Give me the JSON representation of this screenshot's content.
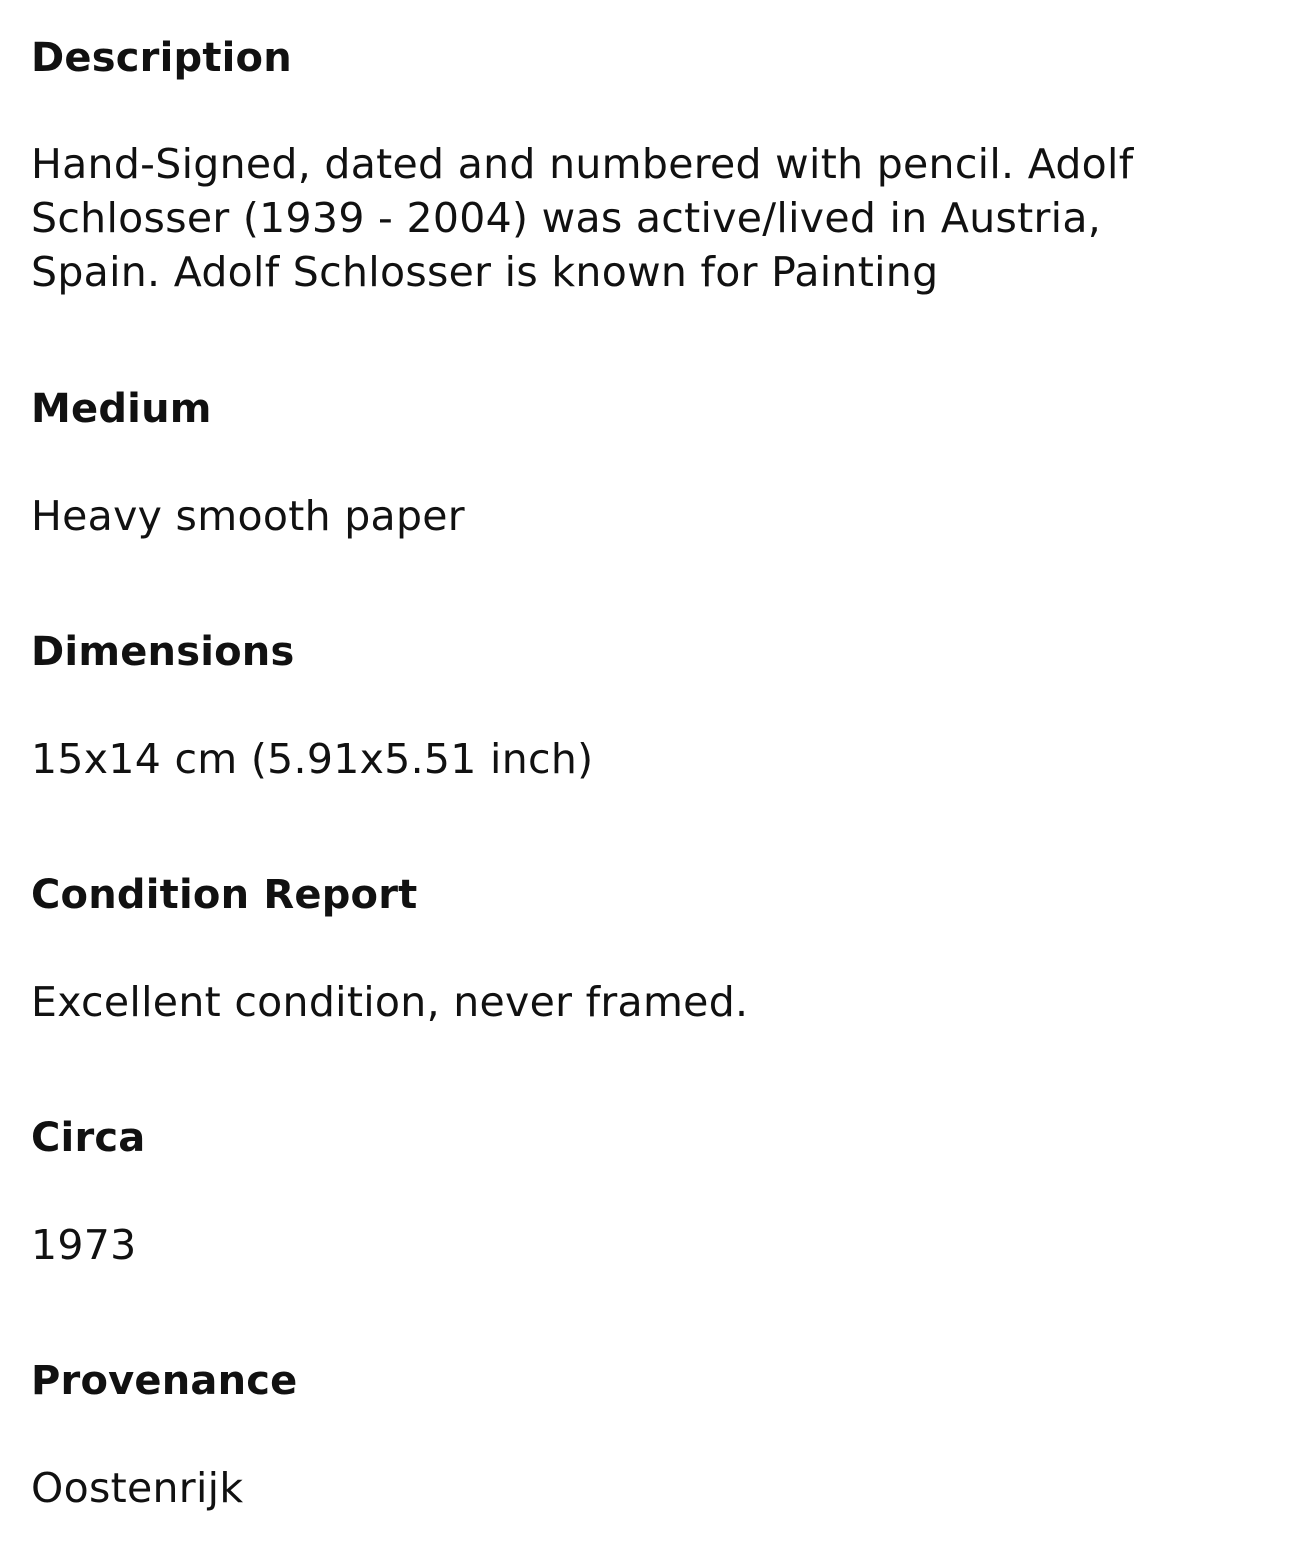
{
  "sections": {
    "description": {
      "heading": "Description",
      "lines": [
        "Hand-Signed, dated and numbered with pencil. Adolf",
        "Schlosser (1939 - 2004) was active/lived in Austria,",
        "Spain. Adolf Schlosser is known for Painting"
      ]
    },
    "medium": {
      "heading": "Medium",
      "value": "Heavy smooth paper"
    },
    "dimensions": {
      "heading": "Dimensions",
      "value": "15x14 cm (5.91x5.51 inch)"
    },
    "condition": {
      "heading": "Condition Report",
      "value": "Excellent condition, never framed."
    },
    "circa": {
      "heading": "Circa",
      "value": "1973"
    },
    "provenance": {
      "heading": "Provenance",
      "value": "Oostenrijk"
    }
  }
}
